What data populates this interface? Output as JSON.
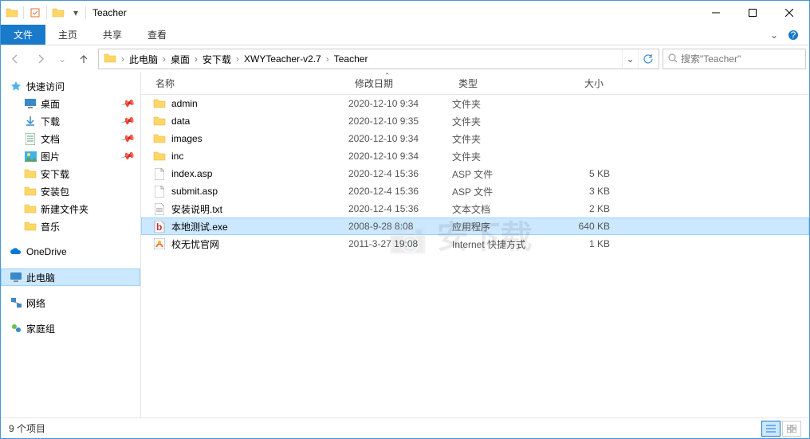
{
  "window": {
    "title": "Teacher"
  },
  "ribbon": {
    "file": "文件",
    "home": "主页",
    "share": "共享",
    "view": "查看"
  },
  "breadcrumb": [
    "此电脑",
    "桌面",
    "安下载",
    "XWYTeacher-v2.7",
    "Teacher"
  ],
  "search": {
    "placeholder": "搜索\"Teacher\""
  },
  "sidebar": {
    "quick": "快速访问",
    "items": [
      {
        "label": "桌面",
        "pin": true,
        "icon": "desktop"
      },
      {
        "label": "下载",
        "pin": true,
        "icon": "download"
      },
      {
        "label": "文档",
        "pin": true,
        "icon": "document"
      },
      {
        "label": "图片",
        "pin": true,
        "icon": "picture"
      },
      {
        "label": "安下载",
        "pin": false,
        "icon": "folder"
      },
      {
        "label": "安装包",
        "pin": false,
        "icon": "folder"
      },
      {
        "label": "新建文件夹",
        "pin": false,
        "icon": "folder"
      },
      {
        "label": "音乐",
        "pin": false,
        "icon": "folder"
      }
    ],
    "onedrive": "OneDrive",
    "thispc": "此电脑",
    "network": "网络",
    "homegroup": "家庭组"
  },
  "columns": {
    "name": "名称",
    "date": "修改日期",
    "type": "类型",
    "size": "大小"
  },
  "files": [
    {
      "name": "admin",
      "date": "2020-12-10 9:34",
      "type": "文件夹",
      "size": "",
      "icon": "folder"
    },
    {
      "name": "data",
      "date": "2020-12-10 9:35",
      "type": "文件夹",
      "size": "",
      "icon": "folder"
    },
    {
      "name": "images",
      "date": "2020-12-10 9:34",
      "type": "文件夹",
      "size": "",
      "icon": "folder"
    },
    {
      "name": "inc",
      "date": "2020-12-10 9:34",
      "type": "文件夹",
      "size": "",
      "icon": "folder"
    },
    {
      "name": "index.asp",
      "date": "2020-12-4 15:36",
      "type": "ASP 文件",
      "size": "5 KB",
      "icon": "file"
    },
    {
      "name": "submit.asp",
      "date": "2020-12-4 15:36",
      "type": "ASP 文件",
      "size": "3 KB",
      "icon": "file"
    },
    {
      "name": "安装说明.txt",
      "date": "2020-12-4 15:36",
      "type": "文本文档",
      "size": "2 KB",
      "icon": "txt"
    },
    {
      "name": "本地测试.exe",
      "date": "2008-9-28 8:08",
      "type": "应用程序",
      "size": "640 KB",
      "icon": "exe",
      "selected": true
    },
    {
      "name": "校无忧官网",
      "date": "2011-3-27 19:08",
      "type": "Internet 快捷方式",
      "size": "1 KB",
      "icon": "url"
    }
  ],
  "status": {
    "count": "9 个项目"
  }
}
